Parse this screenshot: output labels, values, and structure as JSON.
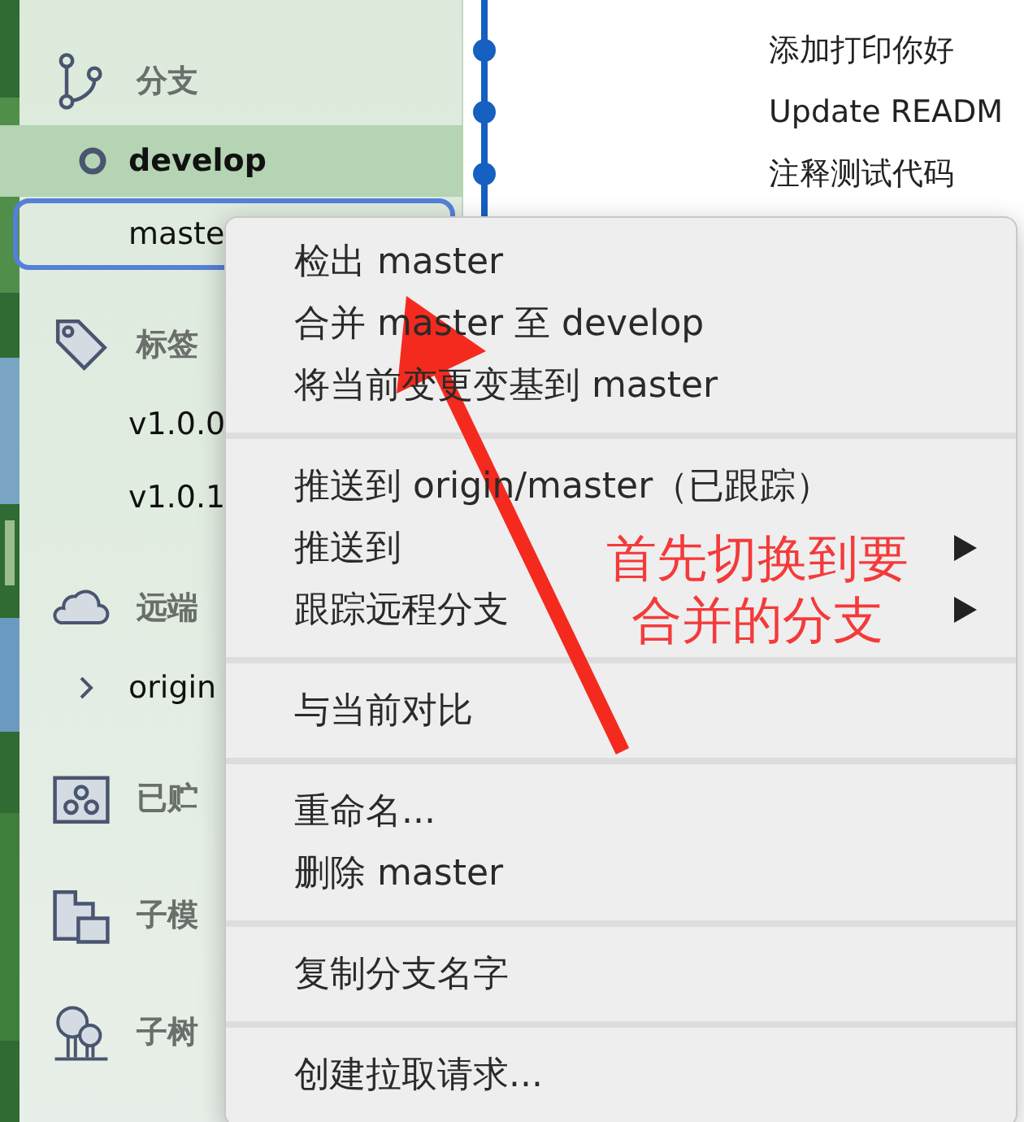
{
  "sidebar": {
    "sections": [
      {
        "title": "分支",
        "items": [
          {
            "label": "develop",
            "current": true,
            "selected": true,
            "focused": false
          },
          {
            "label": "maste",
            "current": false,
            "selected": false,
            "focused": true
          }
        ]
      },
      {
        "title": "标签",
        "items": [
          {
            "label": "v1.0.0",
            "current": false,
            "selected": false,
            "focused": false
          },
          {
            "label": "v1.0.1",
            "current": false,
            "selected": false,
            "focused": false
          }
        ]
      },
      {
        "title": "远端",
        "items": [
          {
            "label": "origin",
            "current": false,
            "selected": false,
            "focused": false,
            "expanded": false
          }
        ]
      },
      {
        "title": "已贮"
      },
      {
        "title": "子模"
      },
      {
        "title": "子树"
      }
    ]
  },
  "commits": [
    {
      "message": "添加打印你好"
    },
    {
      "message": "Update READM"
    },
    {
      "message": "注释测试代码"
    }
  ],
  "context_menu": {
    "groups": [
      [
        {
          "label": "检出 master",
          "submenu": false
        },
        {
          "label": "合并 master 至 develop",
          "submenu": false
        },
        {
          "label": "将当前变更变基到 master",
          "submenu": false
        }
      ],
      [
        {
          "label": "推送到 origin/master（已跟踪）",
          "submenu": false
        },
        {
          "label": "推送到",
          "submenu": true
        },
        {
          "label": "跟踪远程分支",
          "submenu": true
        }
      ],
      [
        {
          "label": "与当前对比",
          "submenu": false
        }
      ],
      [
        {
          "label": "重命名...",
          "submenu": false
        },
        {
          "label": "删除 master",
          "submenu": false
        }
      ],
      [
        {
          "label": "复制分支名字",
          "submenu": false
        }
      ],
      [
        {
          "label": "创建拉取请求...",
          "submenu": false
        }
      ]
    ]
  },
  "annotation": {
    "text": "首先切换到要合并的分支"
  }
}
